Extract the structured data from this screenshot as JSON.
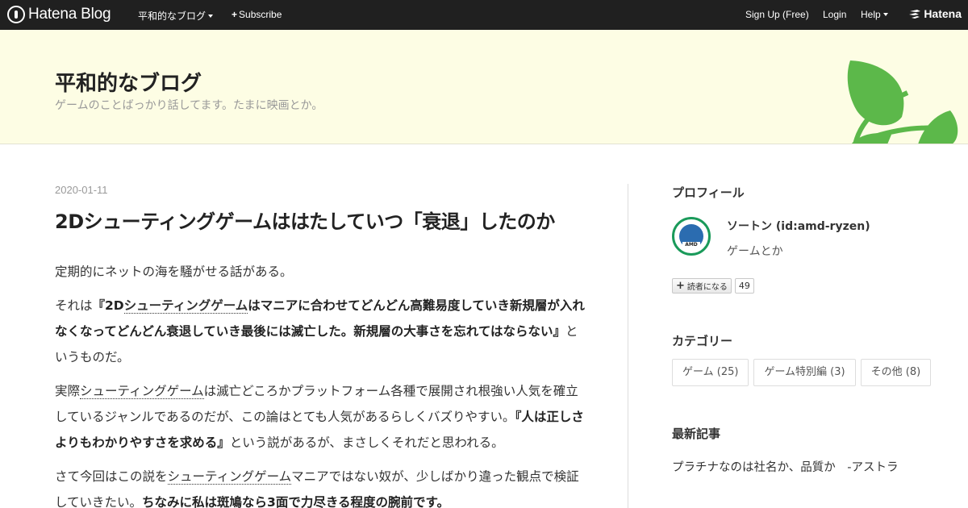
{
  "topbar": {
    "brand": "Hatena Blog",
    "blog_menu": "平和的なブログ",
    "subscribe": "Subscribe",
    "signup": "Sign Up (Free)",
    "login": "Login",
    "help": "Help",
    "hatena": "Hatena"
  },
  "header": {
    "title": "平和的なブログ",
    "description": "ゲームのことばっかり話してます。たまに映画とか。"
  },
  "entry": {
    "date": "2020-01-11",
    "title": "2Dシューティングゲームははたしていつ「衰退」したのか",
    "p1": "定期的にネットの海を騒がせる話がある。",
    "p2_pre": "それは",
    "p2_bold_open": "『2D",
    "p2_bold_kw": "シューティングゲーム",
    "p2_bold_rest": "はマニアに合わせてどんどん高難易度していき新規層が入れなくなってどんどん衰退していき最後には滅亡した。新規層の大事さを忘れてはならない』",
    "p2_post": "というものだ。",
    "p3_pre": "実際",
    "p3_kw": "シューティングゲーム",
    "p3_mid": "は滅亡どころかプラットフォーム各種で展開され根強い人気を確立しているジャンルであるのだが、この論はとても人気があるらしくバズりやすい。",
    "p3_bold": "『人は正しさよりもわかりやすさを求める』",
    "p3_post": "という説があるが、まさしくそれだと思われる。",
    "p4_pre": "さて今回はこの説を",
    "p4_kw": "シューティングゲーム",
    "p4_mid": "マニアではない奴が、少しばかり違った観点で検証していきたい。",
    "p4_bold": "ちなみに私は斑鳩なら3面で力尽きる程度の腕前です。"
  },
  "sidebar": {
    "profile_title": "プロフィール",
    "profile_name": "ソートン (id:amd-ryzen)",
    "profile_desc": "ゲームとか",
    "avatar_text": "AMD",
    "subscribe_label": "読者になる",
    "subscribe_count": "49",
    "category_title": "カテゴリー",
    "categories": [
      "ゲーム (25)",
      "ゲーム特別編 (3)",
      "その他 (8)"
    ],
    "recent_title": "最新記事",
    "recent_first": "プラチナなのは社名か、品質か　-アストラ"
  },
  "colors": {
    "topbar": "#202020",
    "header_bg": "#fdfde4",
    "leaf_green": "#5cb84a"
  }
}
